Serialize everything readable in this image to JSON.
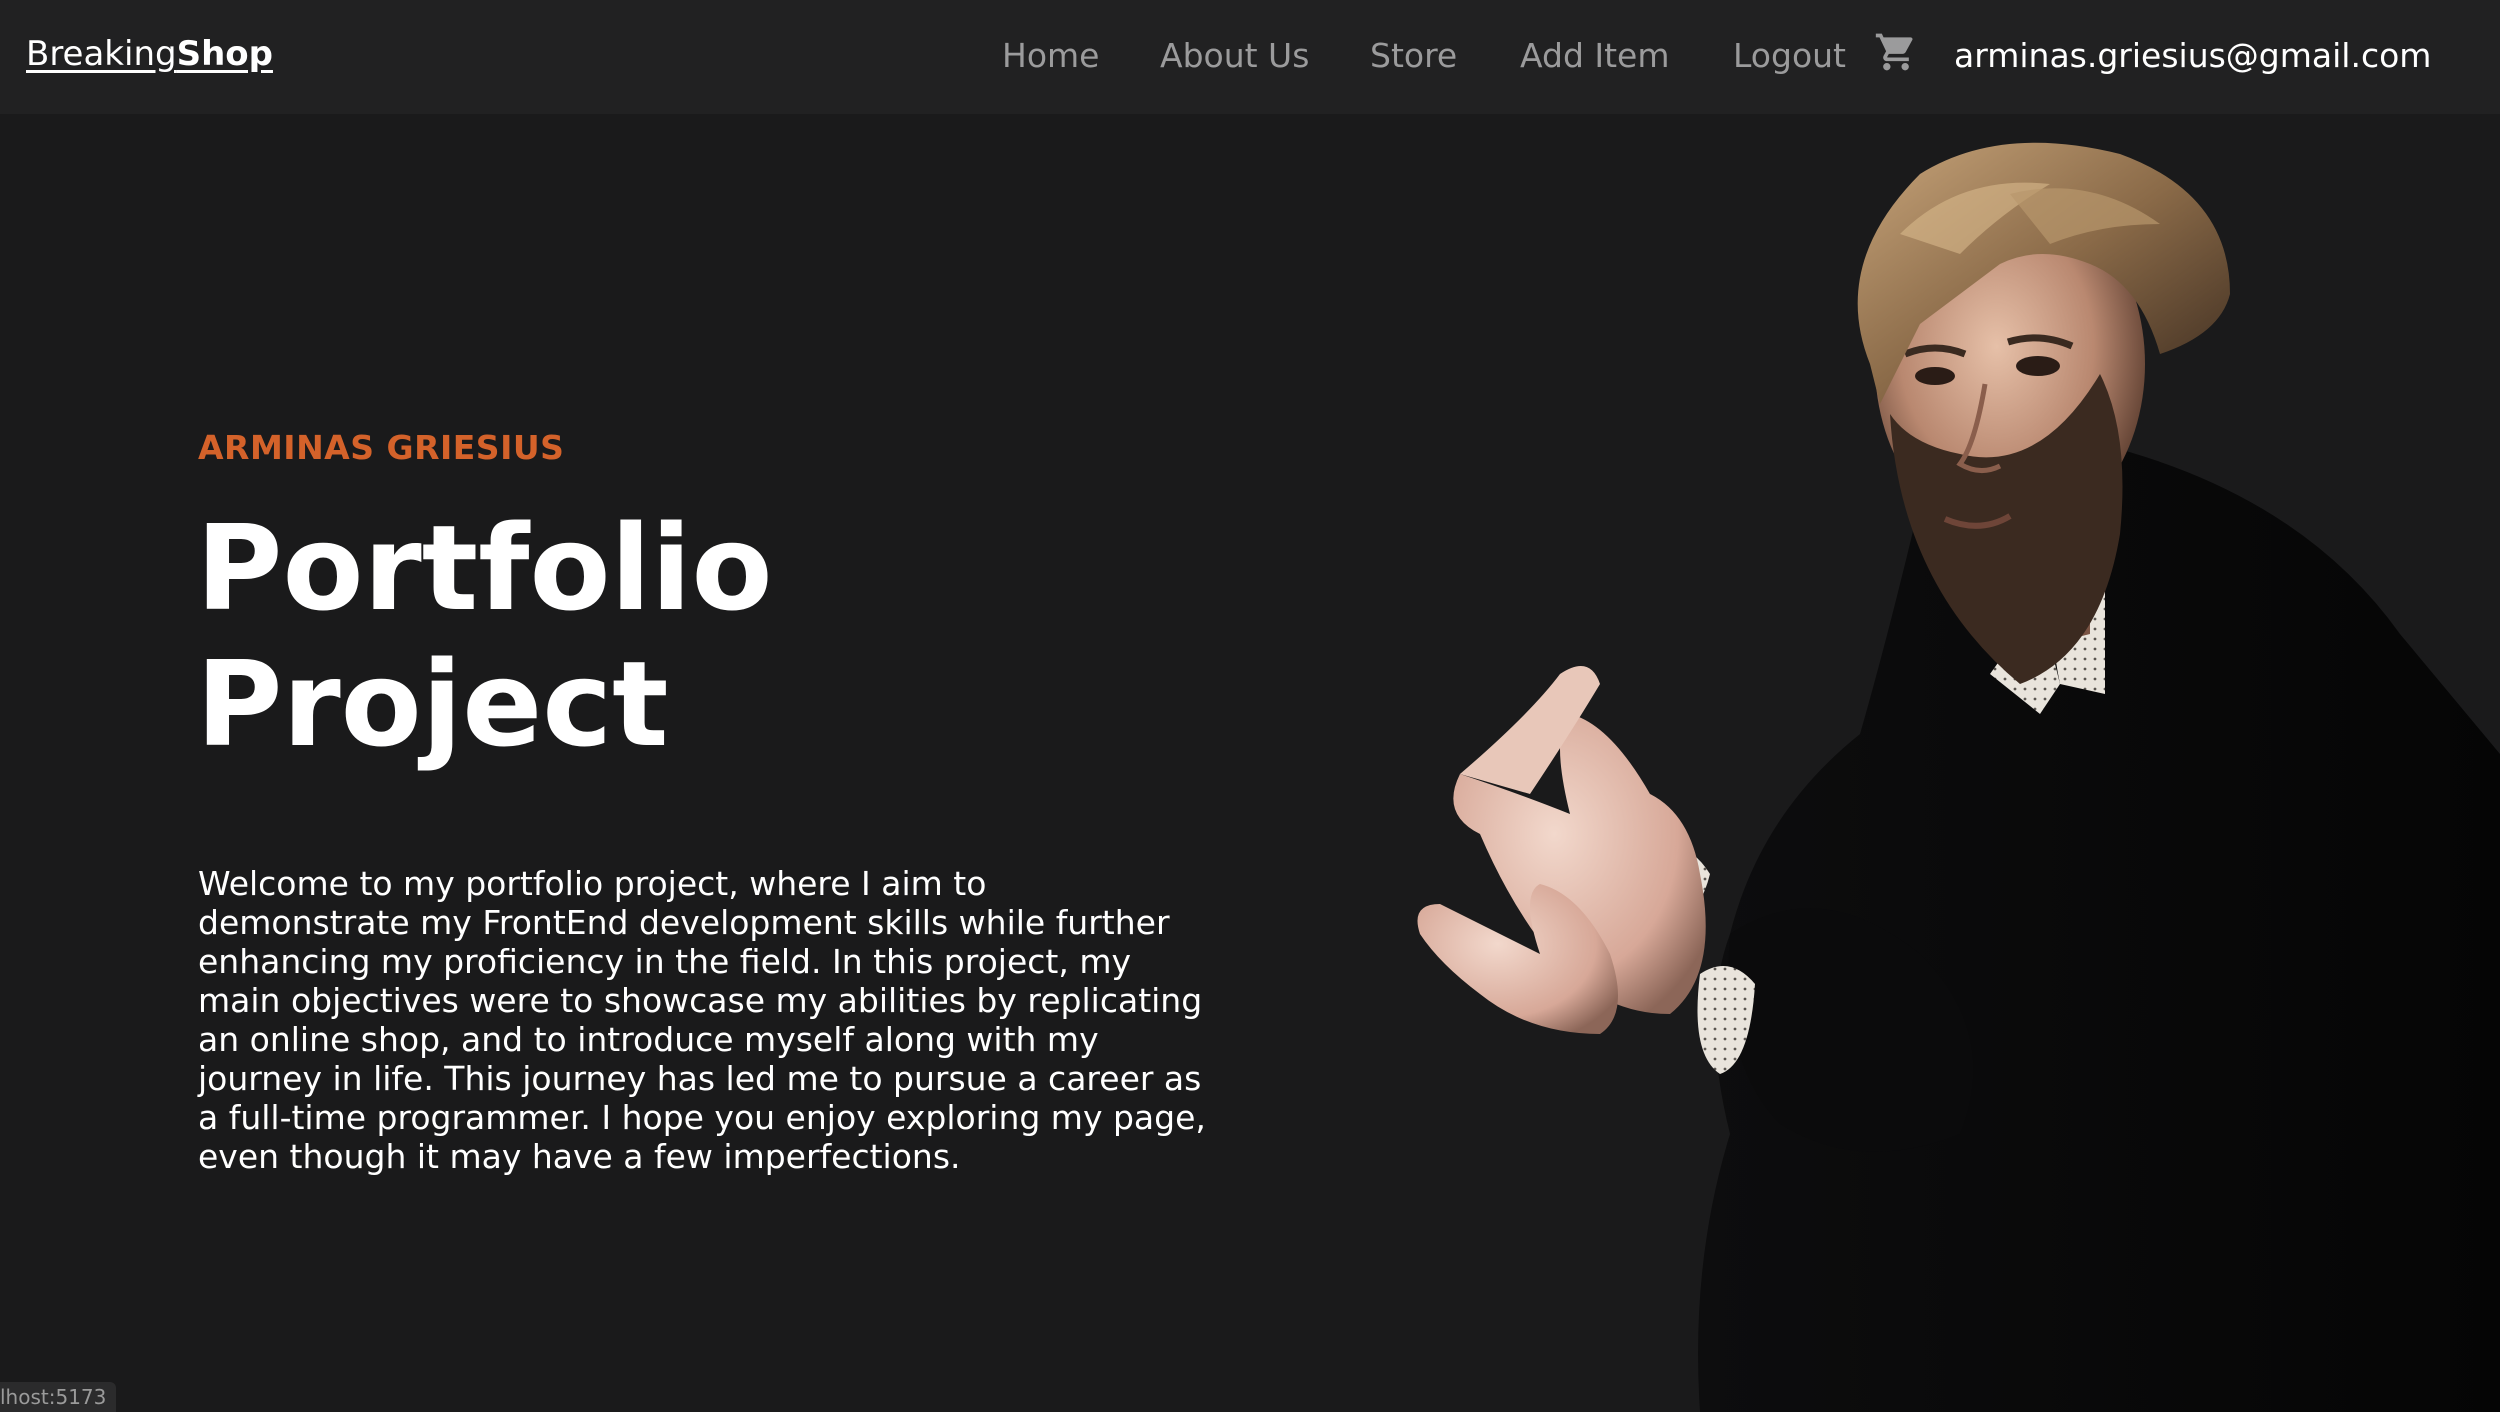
{
  "nav": {
    "brand_regular": "Breaking",
    "brand_bold": "Shop",
    "links": [
      "Home",
      "About Us",
      "Store",
      "Add Item",
      "Logout"
    ],
    "cart_icon": "shopping-cart-icon",
    "user_email": "arminas.griesius@gmail.com"
  },
  "hero": {
    "eyebrow": "ARMINAS GRIESIUS",
    "title_line1": "Portfolio",
    "title_line2": "Project",
    "intro": "Welcome to my portfolio project, where I aim to demonstrate my FrontEnd development skills while further enhancing my proficiency in the field. In this project, my main objectives were to showcase my abilities by replicating an online shop, and to introduce myself along with my journey in life. This journey has led me to pursue a career as a full-time programmer. I hope you enjoy exploring my page, even though it may have a few imperfections."
  },
  "status_bar": {
    "url_fragment": "lhost:5173"
  },
  "colors": {
    "background": "#1a1a1b",
    "navbar": "#212122",
    "accent": "#d4622a",
    "nav_link": "#9b9b9c",
    "text": "#ffffff"
  }
}
